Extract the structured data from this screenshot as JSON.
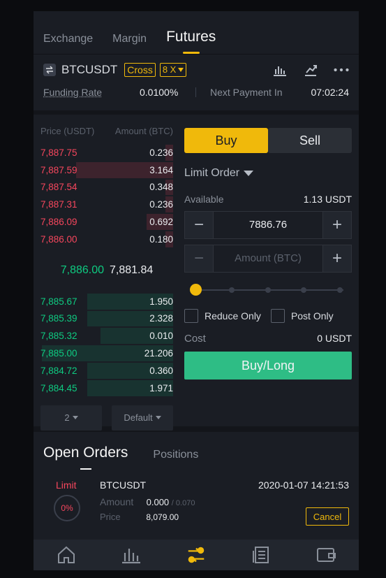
{
  "topbar": {
    "tabs": [
      {
        "label": "Exchange"
      },
      {
        "label": "Margin"
      },
      {
        "label": "Futures"
      }
    ]
  },
  "contract": {
    "symbol": "BTCUSDT",
    "margin_mode": "Cross",
    "leverage": "8 X",
    "funding_rate_label": "Funding Rate",
    "funding_rate": "0.0100%",
    "next_payment_label": "Next Payment In",
    "next_payment": "07:02:24",
    "icons": [
      "swap-icon",
      "chart-icon",
      "calculator-icon",
      "more-icon"
    ]
  },
  "orderbook": {
    "price_header": "Price (USDT)",
    "amount_header": "Amount (BTC)",
    "asks": [
      {
        "price": "7,887.75",
        "amount": "0.236",
        "depth": 0.06
      },
      {
        "price": "7,887.59",
        "amount": "3.164",
        "depth": 0.73
      },
      {
        "price": "7,887.54",
        "amount": "0.348",
        "depth": 0.06
      },
      {
        "price": "7,887.31",
        "amount": "0.236",
        "depth": 0.06
      },
      {
        "price": "7,886.09",
        "amount": "0.692",
        "depth": 0.2
      },
      {
        "price": "7,886.00",
        "amount": "0.180",
        "depth": 0.06
      }
    ],
    "last_price": "7,886.00",
    "mark_price": "7,881.84",
    "bids": [
      {
        "price": "7,885.67",
        "amount": "1.950",
        "depth": 0.65
      },
      {
        "price": "7,885.39",
        "amount": "2.328",
        "depth": 0.65
      },
      {
        "price": "7,885.32",
        "amount": "0.010",
        "depth": 0.55
      },
      {
        "price": "7,885.00",
        "amount": "21.206",
        "depth": 0.99
      },
      {
        "price": "7,884.72",
        "amount": "0.360",
        "depth": 0.65
      },
      {
        "price": "7,884.45",
        "amount": "1.971",
        "depth": 0.65
      }
    ],
    "precision": "2",
    "view": "Default"
  },
  "form": {
    "buy_label": "Buy",
    "sell_label": "Sell",
    "order_type": "Limit Order",
    "available_label": "Available",
    "available_value": "1.13 USDT",
    "price_value": "7886.76",
    "amount_placeholder": "Amount (BTC)",
    "minus": "−",
    "plus": "+",
    "reduce_only_label": "Reduce Only",
    "post_only_label": "Post Only",
    "cost_label": "Cost",
    "cost_value": "0 USDT",
    "submit_label": "Buy/Long",
    "slider_percent": 0
  },
  "orders": {
    "tabs": [
      {
        "label": "Open Orders"
      },
      {
        "label": "Positions"
      }
    ],
    "items": [
      {
        "type": "Limit",
        "filled_percent": "0%",
        "symbol": "BTCUSDT",
        "time": "2020-01-07 14:21:53",
        "amount_label": "Amount",
        "amount": "0.000",
        "total": "/ 0.070",
        "price_label": "Price",
        "price": "8,079.00",
        "cancel_label": "Cancel"
      }
    ]
  },
  "nav": [
    "home-icon",
    "markets-icon",
    "trades-icon",
    "orders-icon",
    "wallet-icon"
  ],
  "colors": {
    "accent": "#f0b90b",
    "buy": "#0ecb81",
    "sell": "#f6465d",
    "long_button": "#2ebd85",
    "background": "#1a1d24"
  }
}
